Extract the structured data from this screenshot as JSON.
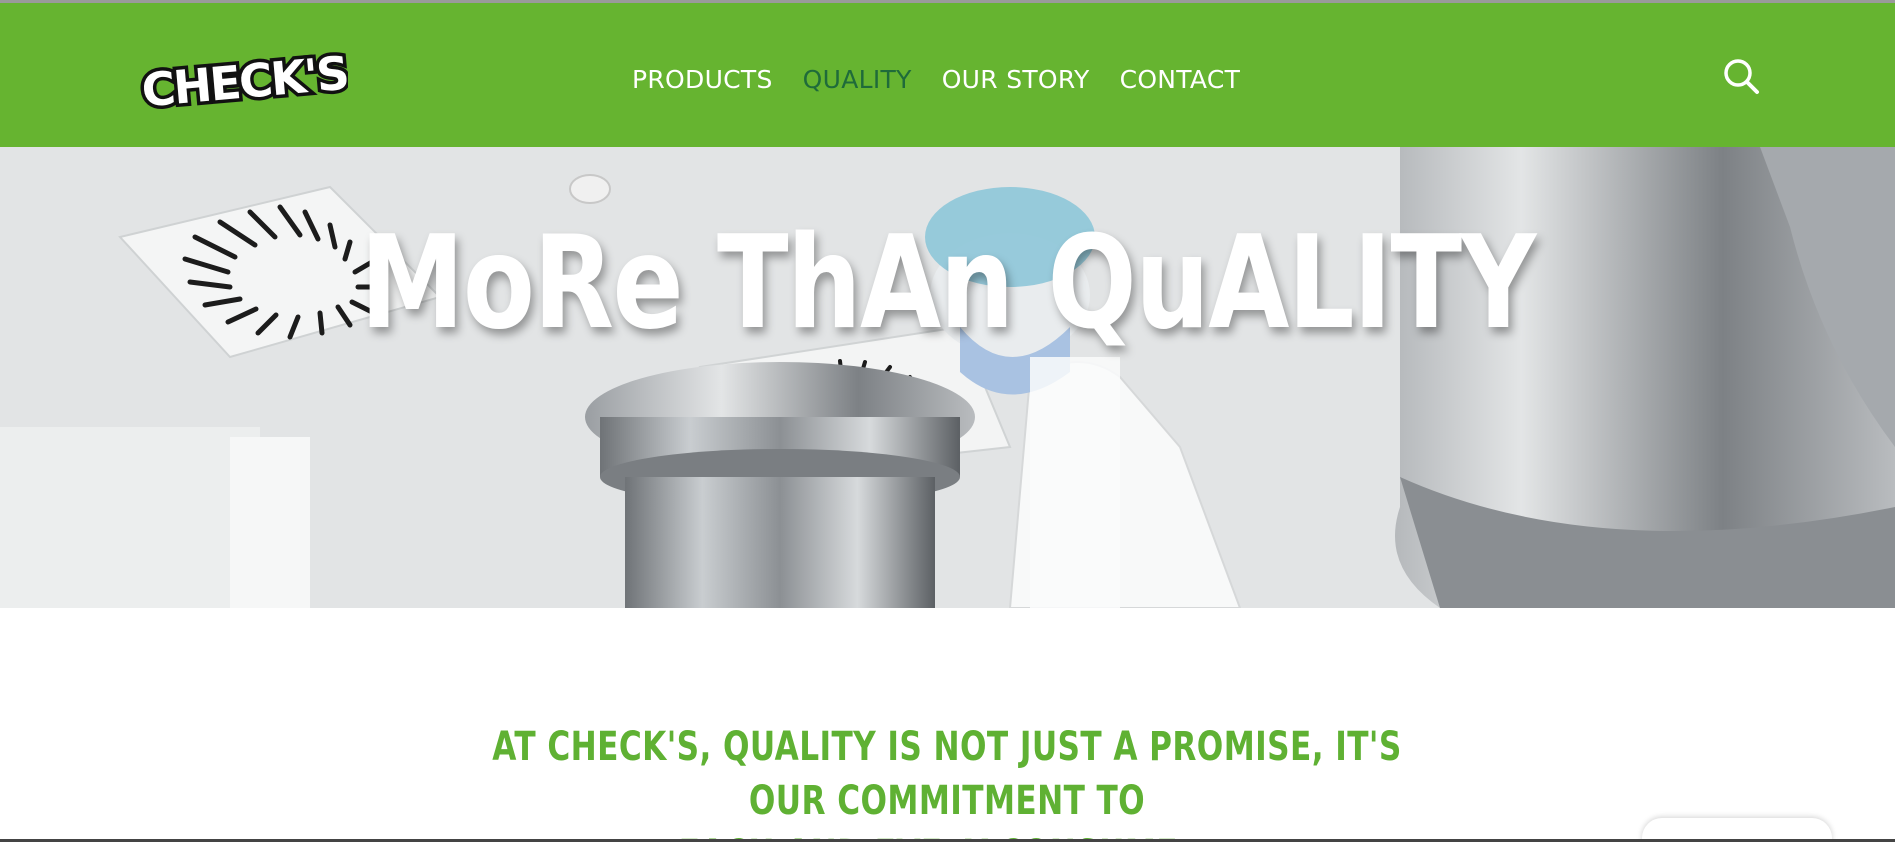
{
  "header": {
    "logo_text": "CHECK'S",
    "nav": [
      {
        "label": "PRODUCTS"
      },
      {
        "label": "QUALITY"
      },
      {
        "label": "OUR STORY"
      },
      {
        "label": "CONTACT"
      }
    ],
    "active_nav": "QUALITY",
    "search_icon": "search-icon"
  },
  "hero": {
    "title": "MoRe ThAn QuALITY"
  },
  "intro": {
    "tagline_line1": "AT CHECK'S, QUALITY IS NOT JUST A PROMISE, IT'S OUR COMMITMENT TO",
    "tagline_line2": "EACH AND EVERY CONSUMER."
  },
  "colors": {
    "brand_green": "#66b430",
    "active_nav": "#1f6b3a",
    "tagline_green": "#5fb133"
  }
}
